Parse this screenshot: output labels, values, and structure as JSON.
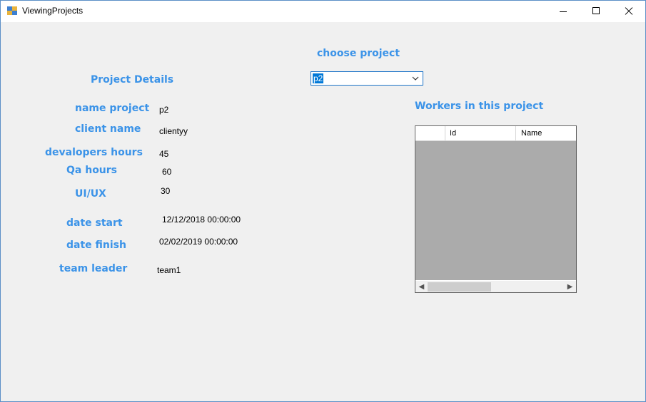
{
  "window": {
    "title": "ViewingProjects"
  },
  "chooser": {
    "label": "choose project",
    "selected": "p2"
  },
  "details": {
    "heading": "Project Details",
    "fields": [
      {
        "label": "name project",
        "value": "p2"
      },
      {
        "label": "client name",
        "value": "clientyy"
      },
      {
        "label": "devalopers hours",
        "value": "45"
      },
      {
        "label": "Qa hours",
        "value": "60"
      },
      {
        "label": "UI/UX",
        "value": "30"
      },
      {
        "label": "date start",
        "value": "12/12/2018 00:00:00"
      },
      {
        "label": "date finish",
        "value": "02/02/2019 00:00:00"
      },
      {
        "label": "team leader",
        "value": "team1"
      }
    ]
  },
  "workers": {
    "heading": "Workers in this project",
    "columns": [
      "Id",
      "Name"
    ],
    "rows": []
  },
  "colors": {
    "caption": "#3b93e8",
    "selection": "#0078d7",
    "grid_background": "#ababab"
  }
}
